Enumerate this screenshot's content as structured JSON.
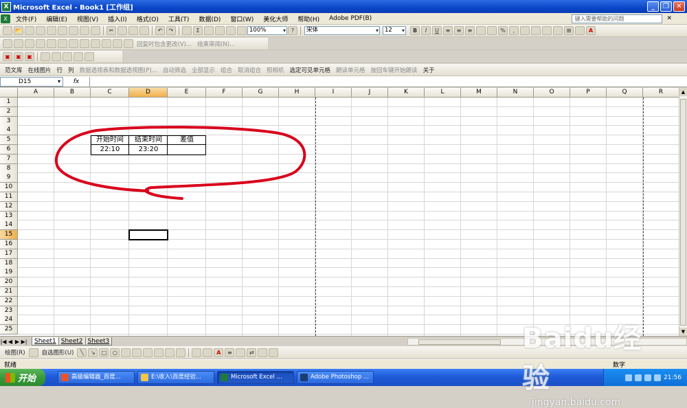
{
  "window": {
    "title": "Microsoft Excel - Book1  [工作组]",
    "minimize": "_",
    "restore": "❐",
    "close": "✕"
  },
  "menu": {
    "items": [
      "文件(F)",
      "编辑(E)",
      "视图(V)",
      "插入(I)",
      "格式(O)",
      "工具(T)",
      "数据(D)",
      "窗口(W)",
      "美化大师",
      "帮助(H)",
      "Adobe PDF(B)"
    ],
    "help_placeholder": "键入需要帮助的问题"
  },
  "toolbar_standard": {
    "zoom": "100%",
    "font_name": "宋体",
    "font_size": "12",
    "bold": "B",
    "italic": "I",
    "underline": "U",
    "percent": "%",
    "sigma": "Σ"
  },
  "toolbar_review": {
    "reply_changes": "回复时包含更改(V)...",
    "end_review": "结束审阅(N)..."
  },
  "toolbar_extra": {
    "items": [
      "范文库",
      "在线图片",
      "行",
      "列",
      "数据透视表和数据透视图(P)...",
      "自动筛选",
      "全部显示",
      "组合",
      "取消组合",
      "照相机",
      "选定可见单元格",
      "朗读单元格",
      "按回车键开始朗读",
      "关于"
    ]
  },
  "formula_bar": {
    "name_box": "D15",
    "fx": "fx",
    "formula": ""
  },
  "sheet": {
    "columns": [
      "A",
      "B",
      "C",
      "D",
      "E",
      "F",
      "G",
      "H",
      "I",
      "J",
      "K",
      "L",
      "M",
      "N",
      "O",
      "P",
      "Q",
      "R"
    ],
    "rows": [
      "1",
      "2",
      "3",
      "4",
      "5",
      "6",
      "7",
      "8",
      "9",
      "10",
      "11",
      "12",
      "13",
      "14",
      "15",
      "16",
      "17",
      "18",
      "19",
      "20",
      "21",
      "22",
      "23",
      "24",
      "25"
    ],
    "selected_column": "D",
    "selected_row": "15",
    "cells": {
      "C5": "开始时间",
      "D5": "结束时间",
      "E5": "差值",
      "C6": "22:10",
      "D6": "23:20",
      "E6": ""
    }
  },
  "sheet_tabs": [
    "Sheet1",
    "Sheet2",
    "Sheet3"
  ],
  "drawing_toolbar": {
    "draw": "绘图(R)",
    "autoshapes": "自选图形(U)"
  },
  "status": {
    "ready": "就绪",
    "mode": "数字"
  },
  "taskbar": {
    "start": "开始",
    "tasks": [
      "高级编辑器_百度...",
      "E:\\收入\\百度经验...",
      "Microsoft Excel ...",
      "Adobe Photoshop ..."
    ],
    "time": "21:56"
  },
  "watermark": {
    "brand": "Baidu经验",
    "url": "jingyan.baidu.com"
  },
  "colors": {
    "title_bar": "#0a46c8",
    "selected_header": "#f0b04c",
    "annotation_ring": "#d9001b",
    "taskbar": "#1f5bd8",
    "start_button": "#3a9a3a"
  }
}
